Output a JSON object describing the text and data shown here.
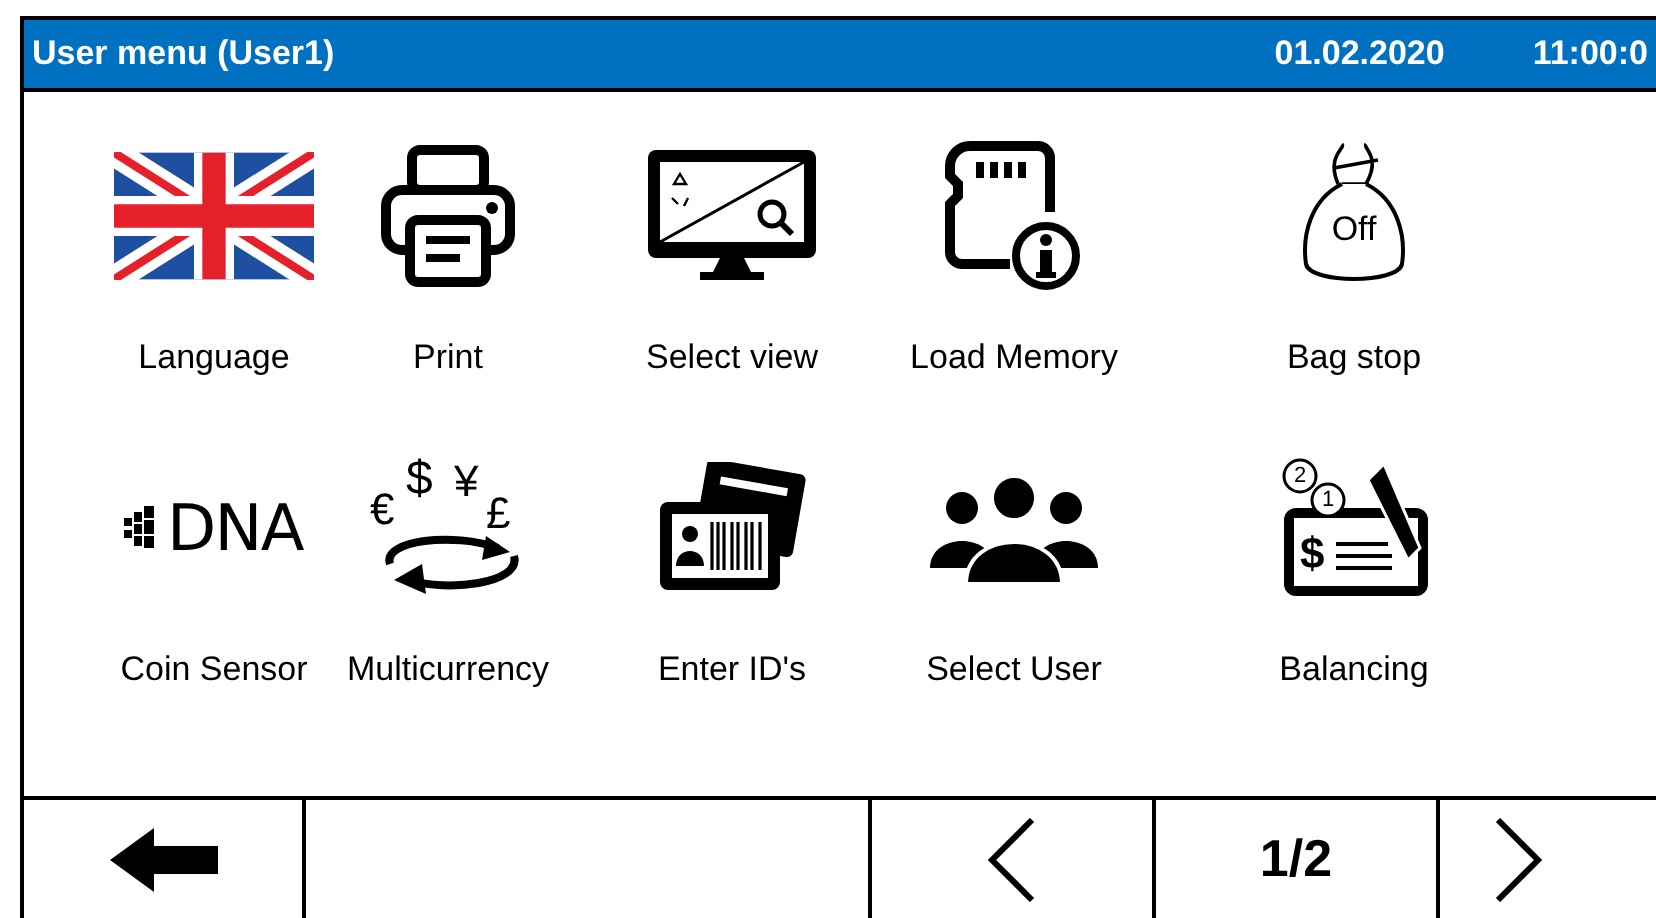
{
  "title_bar": {
    "title": "User menu (User1)",
    "date": "01.02.2020",
    "time": "11:00:0"
  },
  "menu_items": [
    {
      "label": "Language",
      "kind": "flag"
    },
    {
      "label": "Print",
      "kind": "printer"
    },
    {
      "label": "Select view",
      "kind": "monitor"
    },
    {
      "label": "Load Memory",
      "kind": "memory"
    },
    {
      "label": "Bag stop",
      "kind": "bag",
      "icon_text": "Off"
    },
    {
      "label": "Coin Sensor",
      "kind": "dna",
      "icon_text": "DNA"
    },
    {
      "label": "Multicurrency",
      "kind": "currency",
      "glyphs": [
        "€",
        "$",
        "¥",
        "£"
      ]
    },
    {
      "label": "Enter ID's",
      "kind": "idcards"
    },
    {
      "label": "Select User",
      "kind": "users"
    },
    {
      "label": "Balancing",
      "kind": "balance",
      "glyphs": [
        "2",
        "1",
        "$"
      ]
    }
  ],
  "footer": {
    "page": "1/2"
  }
}
